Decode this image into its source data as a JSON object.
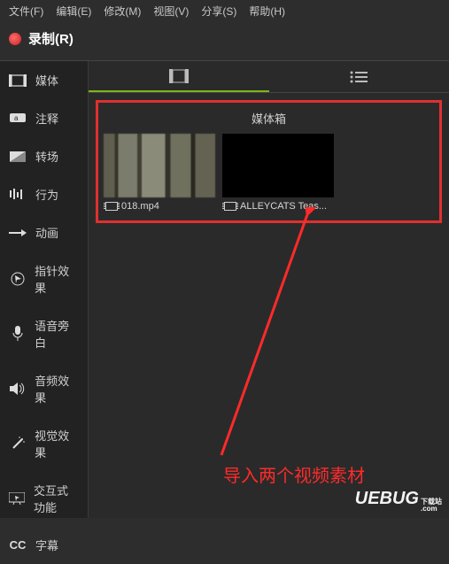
{
  "menu": {
    "file": "文件(F)",
    "edit": "编辑(E)",
    "modify": "修改(M)",
    "view": "视图(V)",
    "share": "分享(S)",
    "help": "帮助(H)"
  },
  "record": {
    "label": "录制(R)"
  },
  "sidebar": {
    "items": [
      {
        "label": "媒体"
      },
      {
        "label": "注释"
      },
      {
        "label": "转场"
      },
      {
        "label": "行为"
      },
      {
        "label": "动画"
      },
      {
        "label": "指针效果"
      },
      {
        "label": "语音旁白"
      },
      {
        "label": "音频效果"
      },
      {
        "label": "视觉效果"
      },
      {
        "label": "交互式功能"
      },
      {
        "label": "字幕"
      }
    ],
    "cc": "CC"
  },
  "panel": {
    "title": "媒体箱"
  },
  "thumbs": [
    {
      "title": "018.mp4"
    },
    {
      "title": "ALLEYCATS Teas..."
    }
  ],
  "annotation": {
    "text": "导入两个视频素材"
  },
  "watermark": {
    "brand": "UEBUG",
    "sub1": "下载站",
    "sub2": ".com"
  }
}
